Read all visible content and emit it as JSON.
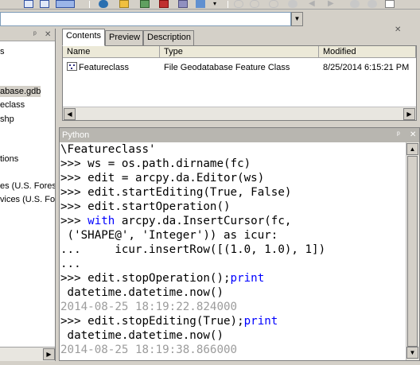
{
  "toolbar": {
    "icons": [
      "list-view-icon",
      "details-view-icon",
      "connect-icon",
      "add-data-icon",
      "disconnect-icon",
      "delete-icon",
      "zoom-in-icon",
      "zoom-out-icon",
      "pan-icon",
      "back-icon",
      "forward-icon",
      "identify-icon",
      "info-icon"
    ]
  },
  "location": {
    "value": ""
  },
  "tree": {
    "items": [
      {
        "label": "s",
        "selected": false
      },
      {
        "label": "abase.gdb",
        "selected": true
      },
      {
        "label": "eclass",
        "selected": false
      },
      {
        "label": "shp",
        "selected": false
      },
      {
        "label": "tions",
        "selected": false
      },
      {
        "label": "es (U.S. Forest",
        "selected": false
      },
      {
        "label": "vices (U.S. Fo",
        "selected": false
      }
    ]
  },
  "content": {
    "tabs": [
      {
        "label": "Contents",
        "active": true
      },
      {
        "label": "Preview",
        "active": false
      },
      {
        "label": "Description",
        "active": false
      }
    ],
    "columns": [
      "Name",
      "Type",
      "Modified"
    ],
    "rows": [
      {
        "name": "Featureclass",
        "type": "File Geodatabase Feature Class",
        "modified": "8/25/2014 6:15:21 PM"
      }
    ]
  },
  "python": {
    "title": "Python",
    "lines": [
      "\\Featureclass'",
      ">>> ws = os.path.dirname(fc)",
      ">>> edit = arcpy.da.Editor(ws)",
      ">>> edit.startEditing(True, False)",
      ">>> edit.startOperation()",
      ">>> with arcpy.da.InsertCursor(fc,",
      " ('SHAPE@', 'Integer')) as icur:",
      "...     icur.insertRow([(1.0, 1.0), 1])",
      "...",
      ">>> edit.stopOperation();print",
      " datetime.datetime.now()",
      "2014-08-25 18:19:22.824000",
      ">>> edit.stopEditing(True);print",
      " datetime.datetime.now()",
      "2014-08-25 18:19:38.866000"
    ],
    "keywords": [
      "with",
      "print"
    ]
  },
  "colors": {
    "keyword": "#0000ff",
    "output": "#9c9c9c",
    "title_bar": "#b8b6b0"
  }
}
